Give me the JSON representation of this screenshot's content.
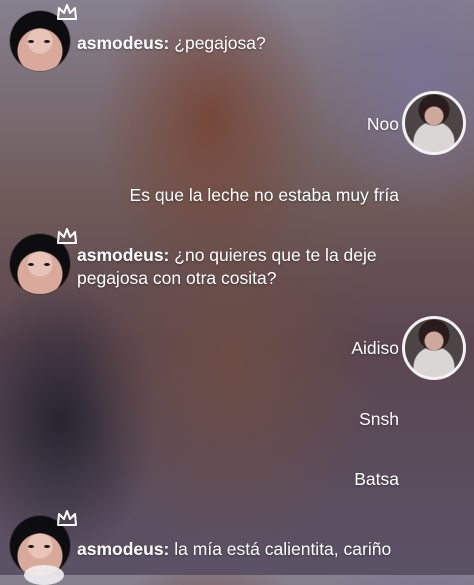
{
  "messages": [
    {
      "side": "left",
      "sender": "asmodeus:",
      "text": "¿pegajosa?"
    },
    {
      "side": "right",
      "text": "Noo"
    },
    {
      "side": "right",
      "text": "Es que la leche no estaba muy fría"
    },
    {
      "side": "left",
      "sender": "asmodeus:",
      "text": "¿no quieres que te la deje pegajosa con otra cosita?"
    },
    {
      "side": "right",
      "text": "Aidiso"
    },
    {
      "side": "right",
      "text": "Snsh"
    },
    {
      "side": "right",
      "text": "Batsa"
    },
    {
      "side": "left",
      "sender": "asmodeus:",
      "text": "la mía está calientita, cariño"
    }
  ],
  "icons": {
    "crown": "crown-icon",
    "avatar_left": "avatar",
    "avatar_right": "avatar"
  }
}
